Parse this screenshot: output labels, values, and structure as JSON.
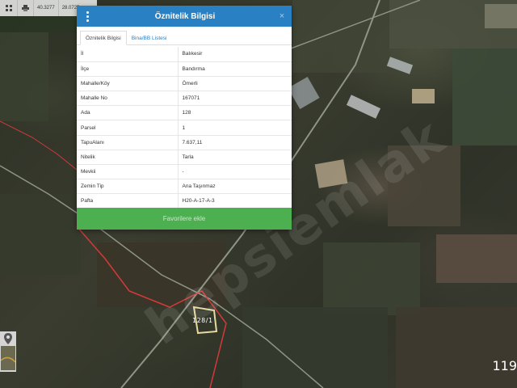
{
  "toolbar": {
    "coord_x": "40.3277",
    "coord_y": "28.0725"
  },
  "popup": {
    "title": "Öznitelik Bilgisi",
    "close_label": "×",
    "tabs": [
      {
        "label": "Öznitelik Bilgisi",
        "active": true
      },
      {
        "label": "Bina/BB Listesi",
        "active": false
      }
    ],
    "rows": [
      {
        "key": "İl",
        "value": "Balıkesir"
      },
      {
        "key": "İlçe",
        "value": "Bandırma"
      },
      {
        "key": "Mahalle/Köy",
        "value": "Ömerli"
      },
      {
        "key": "Mahalle No",
        "value": "167071"
      },
      {
        "key": "Ada",
        "value": "128"
      },
      {
        "key": "Parsel",
        "value": "1"
      },
      {
        "key": "TapuAlanı",
        "value": "7.637,11"
      },
      {
        "key": "Nitelik",
        "value": "Tarla"
      },
      {
        "key": "Mevkii",
        "value": "-"
      },
      {
        "key": "Zemin Tip",
        "value": "Ana Taşınmaz"
      },
      {
        "key": "Pafta",
        "value": "H20-A-17-A-3"
      }
    ],
    "favorite_button": "Favorilere ekle"
  },
  "map": {
    "watermark": "hepsiemlak",
    "parcel_label": "128/1",
    "right_number": "119"
  },
  "colors": {
    "header": "#2980c2",
    "favorite": "#4cb050",
    "parcel_border": "#d33a3a",
    "selected_parcel": "#e8d9a0"
  },
  "icons": {
    "menu": "kebab-menu-icon",
    "close": "close-icon",
    "print": "print-icon",
    "location": "location-pin-icon"
  }
}
